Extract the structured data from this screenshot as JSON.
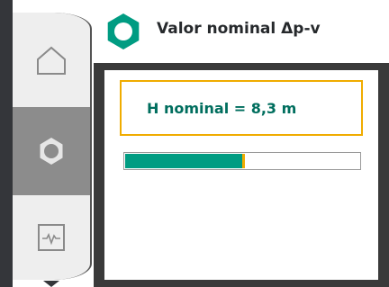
{
  "header": {
    "title": "Valor nominal Δp-v",
    "icon": "gear-icon"
  },
  "sidebar": {
    "items": [
      {
        "icon": "home-icon",
        "active": false
      },
      {
        "icon": "gear-icon",
        "active": true
      },
      {
        "icon": "graph-icon",
        "active": false
      }
    ]
  },
  "setpoint": {
    "label": "H nominal = 8,3 m",
    "progress_fraction": 0.5
  },
  "colors": {
    "accent_green": "#009c82",
    "highlight_yellow": "#f0ac00",
    "dark_bar": "#34363a"
  }
}
